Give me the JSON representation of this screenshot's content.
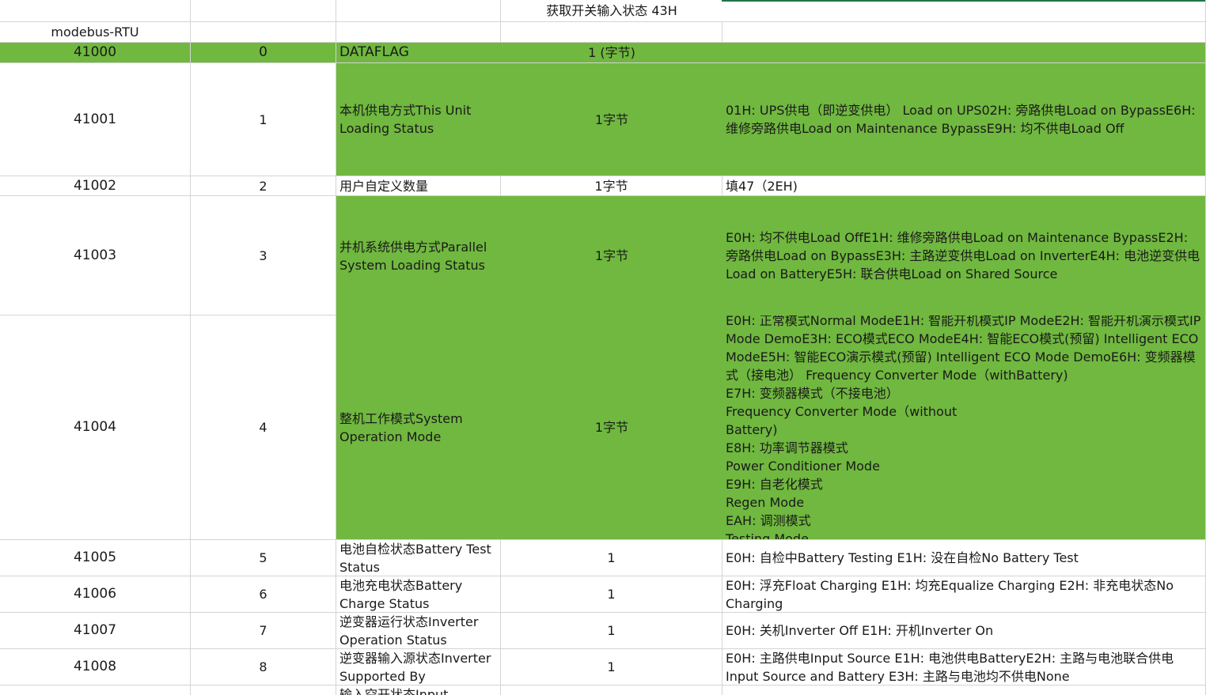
{
  "title": "获取开关输入状态 43H",
  "protocol_label": "modebus-RTU",
  "rows": [
    {
      "register": "41000",
      "index": "0",
      "name": "DATAFLAG",
      "size": "1 (字节)",
      "desc": ""
    },
    {
      "register": "41001",
      "index": "1",
      "name": "本机供电方式This Unit Loading Status",
      "size": "1字节",
      "desc": "01H:  UPS供电（即逆变供电） Load on UPS02H:  旁路供电Load on BypassE6H:  维修旁路供电Load on Maintenance BypassE9H:  均不供电Load Off"
    },
    {
      "register": "41002",
      "index": "2",
      "name": "用户自定义数量",
      "size": "1字节",
      "desc": "填47（2EH)"
    },
    {
      "register": "41003",
      "index": "3",
      "name": "并机系统供电方式Parallel System Loading Status",
      "size": "1字节",
      "desc": "E0H:  均不供电Load OffE1H:  维修旁路供电Load on Maintenance BypassE2H:  旁路供电Load on BypassE3H:  主路逆变供电Load on InverterE4H:  电池逆变供电Load on BatteryE5H:  联合供电Load on Shared Source"
    },
    {
      "register": "41004",
      "index": "4",
      "name": "整机工作模式System Operation Mode",
      "size": "1字节",
      "desc": "E0H:  正常模式Normal ModeE1H: 智能开机模式IP ModeE2H: 智能开机演示模式IP Mode DemoE3H: ECO模式ECO ModeE4H: 智能ECO模式(预留) Intelligent ECO ModeE5H: 智能ECO演示模式(预留) Intelligent ECO Mode DemoE6H: 变频器模式（接电池） Frequency Converter Mode（withBattery)\nE7H: 变频器模式（不接电池）\nFrequency Converter Mode（without\nBattery)\nE8H:  功率调节器模式\nPower Conditioner Mode\nE9H:  自老化模式\nRegen Mode\nEAH: 调测模式\nTesting Mode"
    },
    {
      "register": "41005",
      "index": "5",
      "name": "电池自检状态Battery Test Status",
      "size": "1",
      "desc": "E0H:  自检中Battery Testing E1H:  没在自检No Battery Test"
    },
    {
      "register": "41006",
      "index": "6",
      "name": "电池充电状态Battery Charge Status",
      "size": "1",
      "desc": "E0H:  浮充Float Charging E1H:  均充Equalize Charging E2H:  非充电状态No Charging"
    },
    {
      "register": "41007",
      "index": "7",
      "name": "逆变器运行状态Inverter Operation Status",
      "size": "1",
      "desc": "E0H:  关机Inverter Off E1H:  开机Inverter On"
    },
    {
      "register": "41008",
      "index": "8",
      "name": "逆变器输入源状态Inverter Supported By",
      "size": "1",
      "desc": "E0H:  主路供电Input Source E1H:  电池供电BatteryE2H:  主路与电池联合供电Input Source and Battery E3H:  主路与电池均不供电None"
    },
    {
      "register": "",
      "index": "",
      "name": "输入空开状态Input",
      "size": "",
      "desc": ""
    }
  ]
}
